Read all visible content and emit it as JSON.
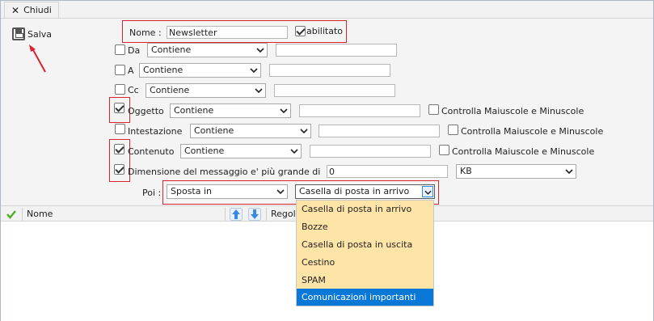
{
  "tab": {
    "label": "Chiudi",
    "icon": "close-icon"
  },
  "toolbar": {
    "save_label": "Salva",
    "save_icon": "floppy-disk-icon"
  },
  "rule": {
    "name_label": "Nome :",
    "name_value": "Newsletter",
    "enabled_label": "abilitato",
    "enabled": true
  },
  "conditions": {
    "from": {
      "label": "Da",
      "checked": false,
      "operator": "Contiene",
      "value": ""
    },
    "to": {
      "label": "A",
      "checked": false,
      "operator": "Contiene",
      "value": ""
    },
    "cc": {
      "label": "Cc",
      "checked": false,
      "operator": "Contiene",
      "value": ""
    },
    "subject": {
      "label": "Oggetto",
      "checked": true,
      "operator": "Contiene",
      "value": "",
      "case_label": "Controlla Maiuscole e Minuscole",
      "case_checked": false
    },
    "header": {
      "label": "Intestazione",
      "checked": false,
      "operator": "Contiene",
      "value": "",
      "case_label": "Controlla Maiuscole e Minuscole",
      "case_checked": false
    },
    "content": {
      "label": "Contenuto",
      "checked": true,
      "operator": "Contiene",
      "value": "",
      "case_label": "Controlla Maiuscole e Minuscole",
      "case_checked": false
    },
    "size": {
      "label": "Dimensione del messaggio e' più grande di",
      "checked": true,
      "value": "0",
      "unit": "KB"
    }
  },
  "action": {
    "label": "Poi :",
    "type": "Sposta in",
    "folder": "Casella di posta in arrivo",
    "options": [
      "Casella di posta in arrivo",
      "Bozze",
      "Casella di posta in uscita",
      "Cestino",
      "SPAM",
      "Comunicazioni importanti"
    ],
    "highlighted_index": 5
  },
  "grid": {
    "col_name": "Nome",
    "col_rule": "Regola",
    "check_icon": "checkmark-icon",
    "up_icon": "arrow-up-icon",
    "down_icon": "arrow-down-icon"
  },
  "colors": {
    "highlight_red": "#d9232e",
    "dropdown_bg": "#ffe4a8",
    "selection_blue": "#0a78d7",
    "arrow_blue": "#3b88e0",
    "check_green": "#4caf2a"
  }
}
